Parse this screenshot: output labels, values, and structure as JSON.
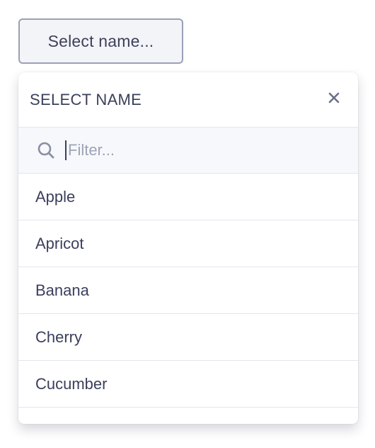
{
  "trigger": {
    "label": "Select name..."
  },
  "popover": {
    "title": "SELECT NAME",
    "close_icon": "close-icon",
    "filter": {
      "placeholder": "Filter...",
      "value": "",
      "icon": "search-icon"
    },
    "options": [
      {
        "label": "Apple"
      },
      {
        "label": "Apricot"
      },
      {
        "label": "Banana"
      },
      {
        "label": "Cherry"
      },
      {
        "label": "Cucumber"
      },
      {
        "label": ""
      }
    ]
  },
  "colors": {
    "text": "#3b3f5c",
    "border": "#9aa0b8",
    "divider": "#e4e6ec",
    "filter_bg": "#f6f8fc",
    "icon": "#7b8096"
  }
}
